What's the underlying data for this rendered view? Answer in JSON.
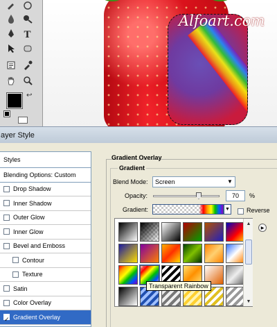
{
  "canvas": {
    "watermark": "Alfoart.com"
  },
  "dialog": {
    "title": "ayer Style",
    "styles_header": "Styles",
    "blending_options": "Blending Options: Custom",
    "styles": [
      {
        "label": "Drop Shadow",
        "checked": false,
        "indent": false
      },
      {
        "label": "Inner Shadow",
        "checked": false,
        "indent": false
      },
      {
        "label": "Outer Glow",
        "checked": false,
        "indent": false
      },
      {
        "label": "Inner Glow",
        "checked": false,
        "indent": false
      },
      {
        "label": "Bevel and Emboss",
        "checked": false,
        "indent": false
      },
      {
        "label": "Contour",
        "checked": false,
        "indent": true
      },
      {
        "label": "Texture",
        "checked": false,
        "indent": true
      },
      {
        "label": "Satin",
        "checked": false,
        "indent": false
      },
      {
        "label": "Color Overlay",
        "checked": false,
        "indent": false
      },
      {
        "label": "Gradient Overlay",
        "checked": true,
        "indent": false,
        "active": true
      }
    ],
    "section_title": "Gradient Overlay",
    "group_title": "Gradient",
    "blend_mode_label": "Blend Mode:",
    "blend_mode_value": "Screen",
    "opacity_label": "Opacity:",
    "opacity_value": "70",
    "opacity_unit": "%",
    "opacity_level": 0.7,
    "gradient_label": "Gradient:",
    "reverse_label": "Reverse",
    "reverse_checked": false,
    "tooltip": "Transparent Rainbow"
  },
  "colors": {
    "selection": "#316ac5",
    "foreground": "#000000"
  },
  "icons": [
    "marquee-icon",
    "move-icon",
    "lasso-icon",
    "magic-wand-icon",
    "crop-icon",
    "slice-icon",
    "brush-icon",
    "stamp-icon",
    "eraser-icon",
    "gradient-icon",
    "burn-icon",
    "drop-icon",
    "pen-icon",
    "text-icon",
    "path-select-icon",
    "shape-icon",
    "notes-icon",
    "eyedropper-icon",
    "hand-icon",
    "zoom-icon"
  ]
}
